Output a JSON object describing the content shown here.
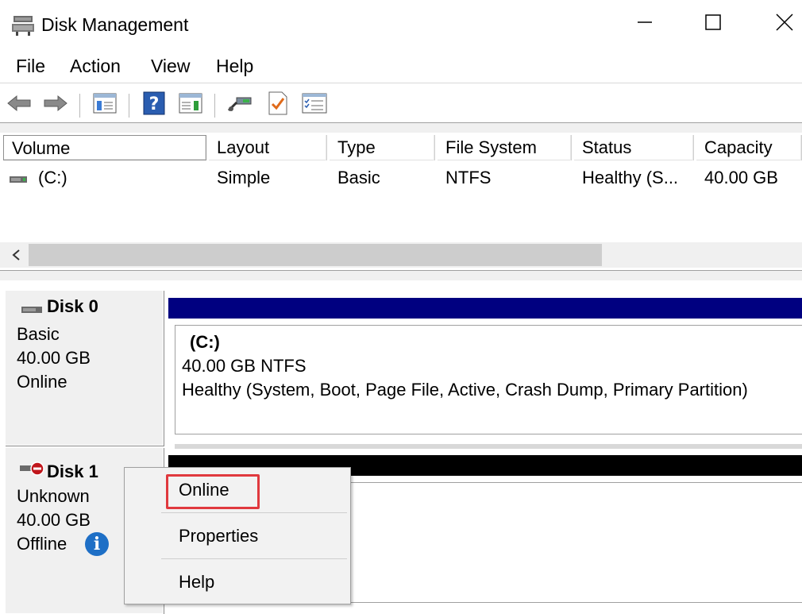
{
  "window": {
    "title": "Disk Management",
    "icon": "disk-management-icon",
    "controls": [
      "minimize-icon",
      "maximize-icon",
      "close-icon"
    ]
  },
  "menu": {
    "items": [
      {
        "label": "File"
      },
      {
        "label": "Action"
      },
      {
        "label": "View"
      },
      {
        "label": "Help"
      }
    ]
  },
  "toolbar": {
    "icons": [
      "back-arrow-icon",
      "forward-arrow-icon",
      "console-tree-icon",
      "help-icon",
      "action-pane-icon",
      "connect-icon",
      "check-icon",
      "properties-icon"
    ]
  },
  "volume_list": {
    "columns": [
      "Volume",
      "Layout",
      "Type",
      "File System",
      "Status",
      "Capacity"
    ],
    "rows": [
      {
        "volume": "(C:)",
        "layout": "Simple",
        "type": "Basic",
        "file_system": "NTFS",
        "status": "Healthy (S...",
        "capacity": "40.00 GB"
      }
    ]
  },
  "disks": [
    {
      "name": "Disk 0",
      "kind": "Basic",
      "size": "40.00 GB",
      "state": "Online",
      "partition": {
        "title": "(C:)",
        "size_fs": "40.00 GB NTFS",
        "status": "Healthy (System, Boot, Page File, Active, Crash Dump, Primary Partition)"
      },
      "bar_color": "#000080"
    },
    {
      "name": "Disk 1",
      "kind": "Unknown",
      "size": "40.00 GB",
      "state": "Offline",
      "bar_color": "#000000"
    }
  ],
  "context_menu": {
    "items": [
      {
        "label": "Online",
        "highlighted": true
      },
      {
        "label": "Properties"
      },
      {
        "label": "Help"
      }
    ],
    "highlight_color": "#e0393e"
  }
}
